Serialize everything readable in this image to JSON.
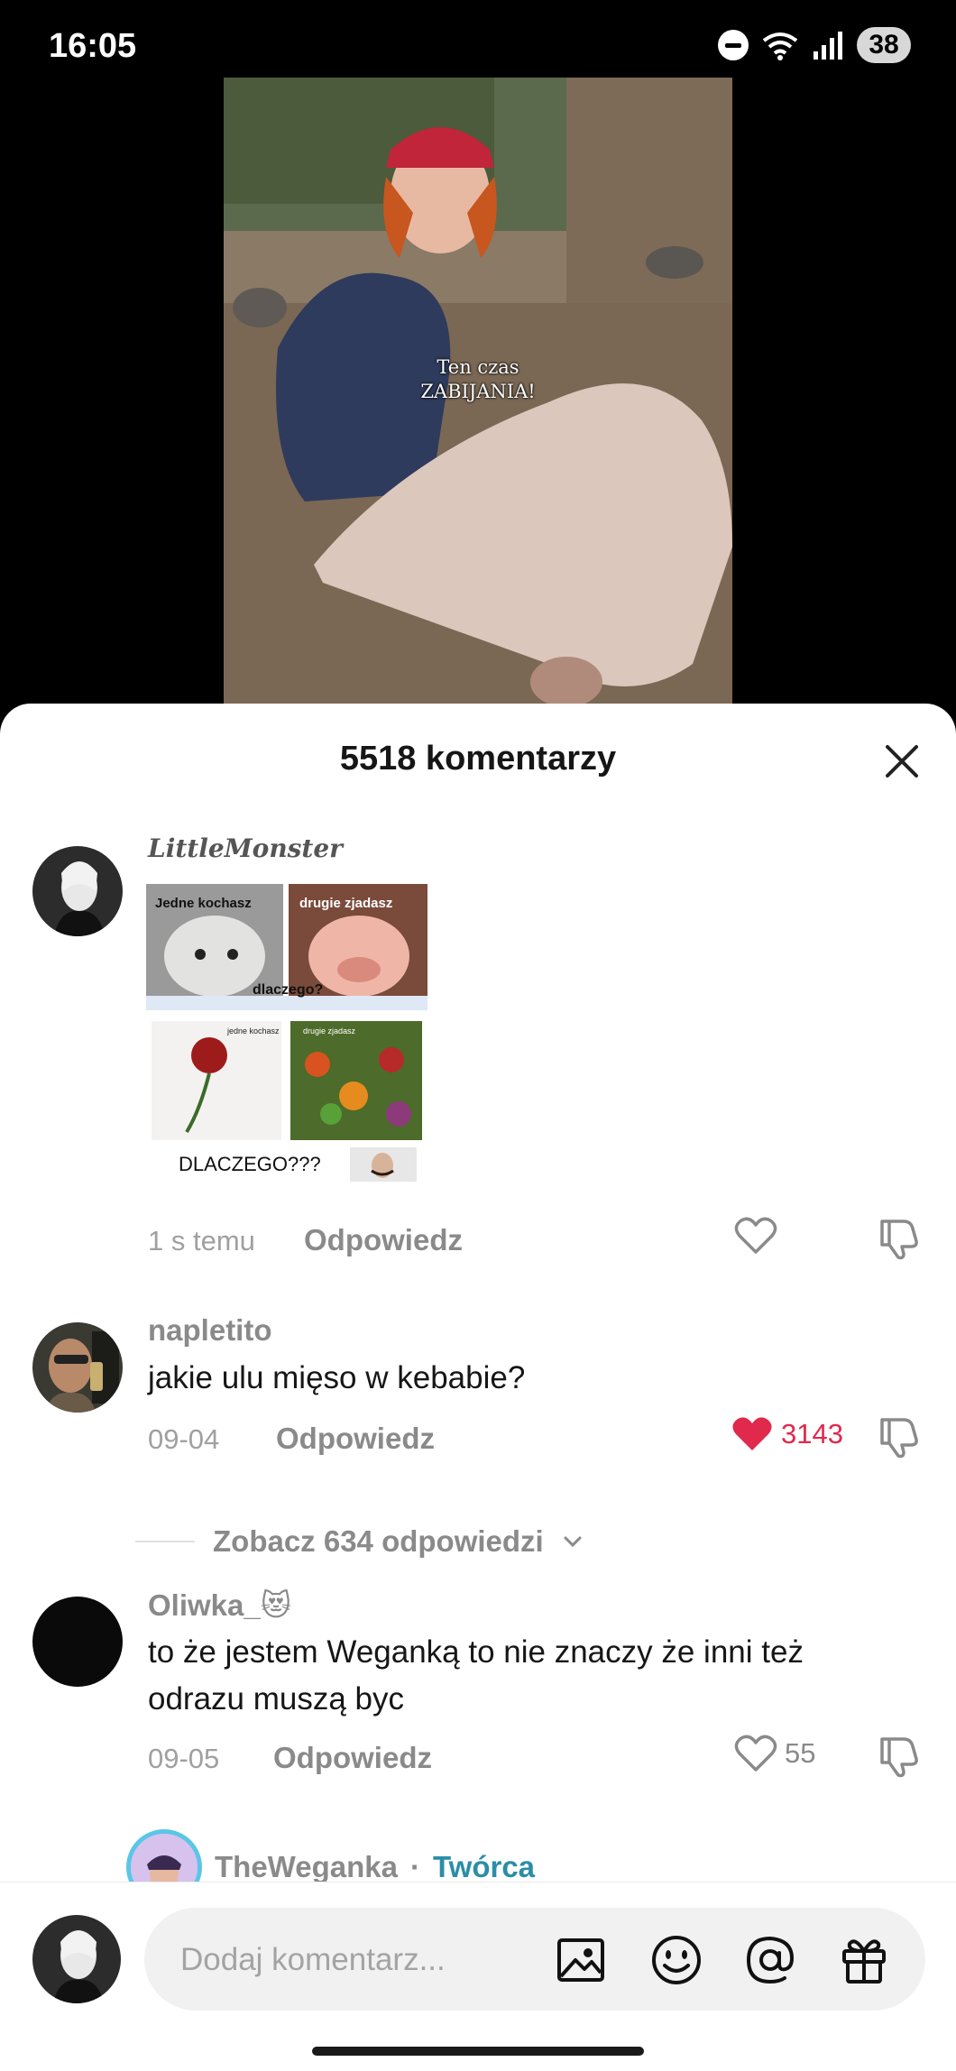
{
  "status_bar": {
    "time": "16:05",
    "battery": "38"
  },
  "video": {
    "caption_line1": "Ten czas",
    "caption_line2": "ZABIJANIA!"
  },
  "sheet": {
    "title": "5518 komentarzy"
  },
  "comments": [
    {
      "user": "LittleMonster",
      "sticker_texts": [
        "Jedne kochasz",
        "drugie zjadasz",
        "dlaczego?",
        "jedne kochasz",
        "drugie zjadasz",
        "DLACZEGO???"
      ],
      "date": "1 s temu",
      "reply": "Odpowiedz"
    },
    {
      "user": "napletito",
      "text": "jakie ulu mięso w kebabie?",
      "date": "09-04",
      "reply": "Odpowiedz",
      "likes": "3143"
    },
    {
      "user": "Oliwka_😻",
      "text": "to że jestem Weganką to nie znaczy że inni też odrazu muszą byc",
      "date": "09-05",
      "reply": "Odpowiedz",
      "likes": "55"
    }
  ],
  "view_replies": "Zobacz 634 odpowiedzi",
  "creator_reply": {
    "user": "TheWeganka",
    "separator": "·",
    "badge": "Twórca"
  },
  "input": {
    "placeholder": "Dodaj komentarz..."
  },
  "colors": {
    "like_active": "#e0294c",
    "creator_badge": "#2b8da7"
  }
}
